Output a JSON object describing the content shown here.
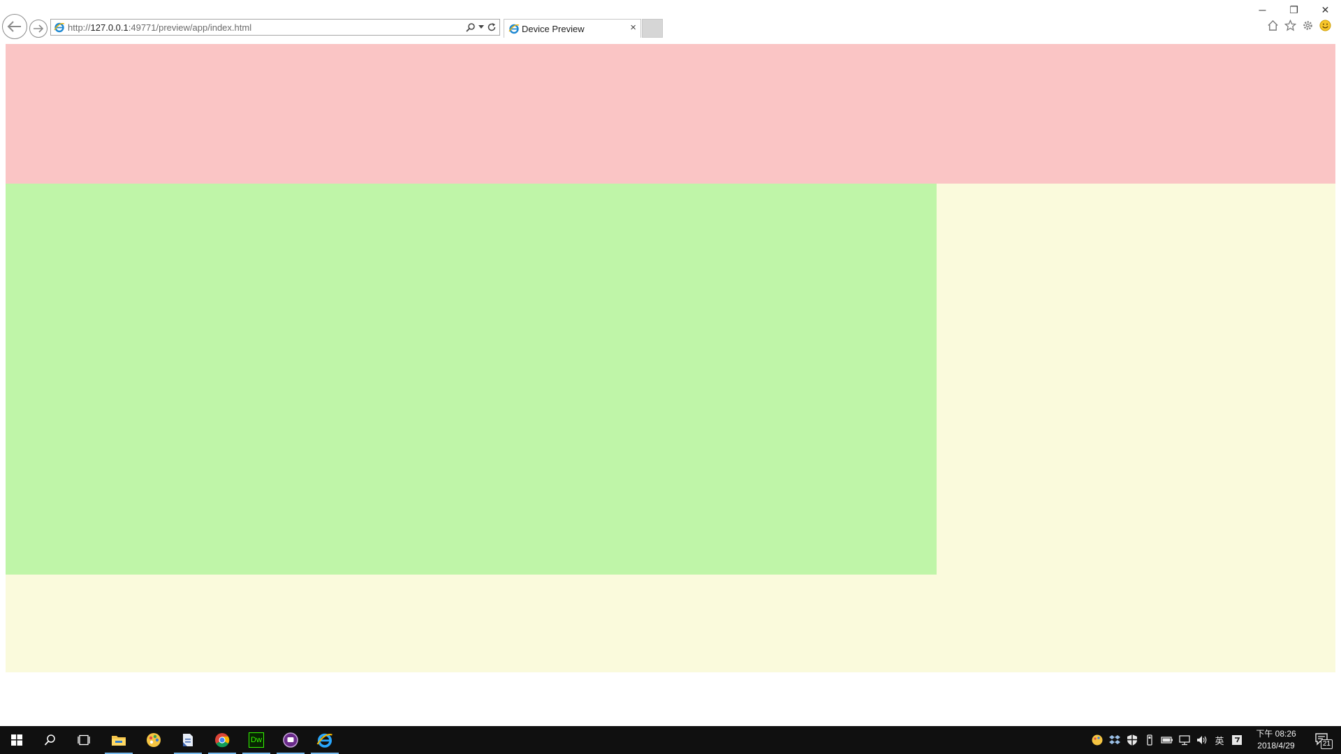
{
  "browser": {
    "url_prefix": "http://",
    "url_host": "127.0.0.1",
    "url_rest": ":49771/preview/app/index.html",
    "tab_title": "Device Preview",
    "tab_close": "×",
    "icons": {
      "back": "back-arrow-icon",
      "forward": "forward-arrow-icon",
      "search": "search-icon",
      "refresh": "refresh-icon",
      "home": "home-icon",
      "favorites": "star-icon",
      "settings": "gear-icon",
      "feedback": "smiley-icon"
    },
    "window_controls": {
      "minimize": "─",
      "restore": "❐",
      "close": "✕"
    }
  },
  "page": {
    "colors": {
      "header": "#fac5c5",
      "main": "#bff5a8",
      "background": "#fafadc"
    }
  },
  "taskbar": {
    "apps": [
      {
        "name": "file-explorer-icon",
        "active": true
      },
      {
        "name": "paint-palette-icon",
        "active": false
      },
      {
        "name": "notepad-app-icon",
        "active": true
      },
      {
        "name": "chrome-icon",
        "active": true
      },
      {
        "name": "dreamweaver-icon",
        "label": "Dw",
        "active": true
      },
      {
        "name": "purple-app-icon",
        "active": true
      },
      {
        "name": "internet-explorer-icon",
        "active": true
      }
    ],
    "ime_label": "英",
    "clock": {
      "time": "下午 08:26",
      "date": "2018/4/29"
    },
    "notification_count": "21"
  }
}
